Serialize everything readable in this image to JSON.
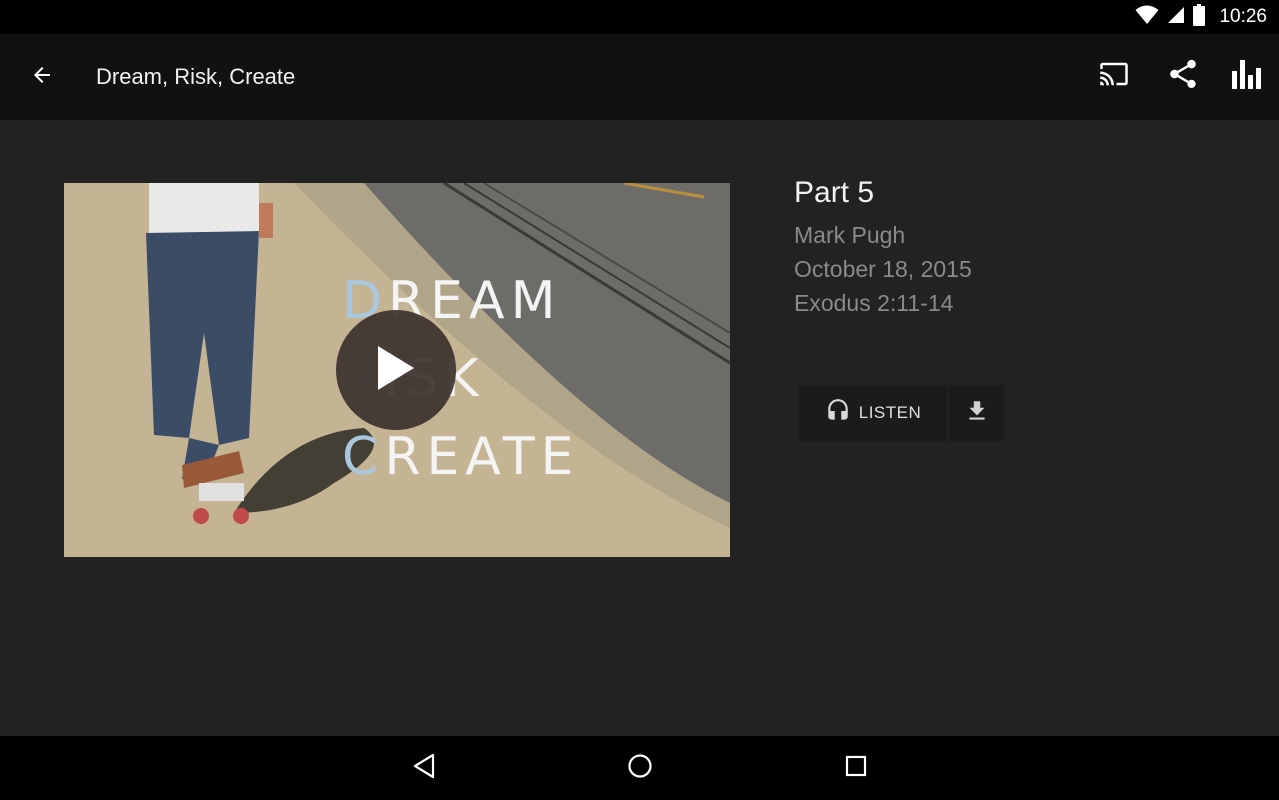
{
  "status_bar": {
    "time": "10:26"
  },
  "app_bar": {
    "title": "Dream, Risk, Create",
    "icons": [
      "arrow-back-icon",
      "cast-icon",
      "share-icon",
      "stats-icon"
    ]
  },
  "sermon": {
    "artwork_lines": [
      {
        "first": "D",
        "rest": "REAM"
      },
      {
        "first": "R",
        "rest": "ISK"
      },
      {
        "first": "C",
        "rest": "REATE"
      }
    ],
    "part": "Part 5",
    "speaker": "Mark Pugh",
    "date": "October 18, 2015",
    "scripture": "Exodus 2:11-14",
    "listen_label": "LISTEN"
  },
  "colors": {
    "background": "#222222",
    "app_bar": "#111111",
    "meta_text": "#8a8a8a",
    "artwork_accent": "#a9c8e0"
  }
}
